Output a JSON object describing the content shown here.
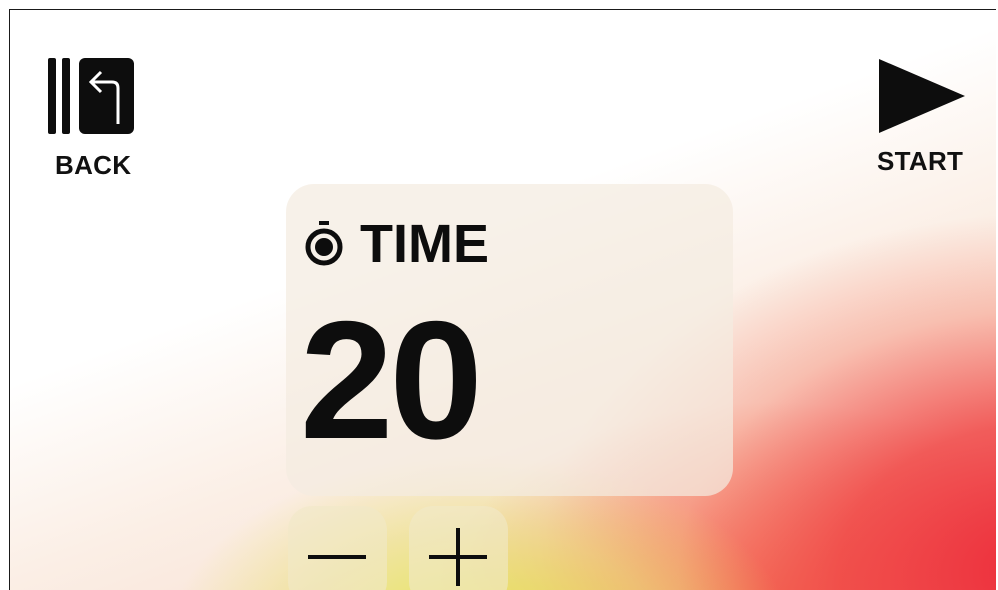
{
  "back": {
    "label": "BACK",
    "icon": "back-door-icon"
  },
  "start": {
    "label": "START",
    "icon": "play-icon"
  },
  "time_card": {
    "title": "TIME",
    "value": "20",
    "icon": "stopwatch-icon"
  },
  "stepper": {
    "minus_icon": "minus-icon",
    "plus_icon": "plus-icon"
  },
  "colors": {
    "text": "#0d0d0d",
    "accent_red": "#ec2838",
    "accent_yellow": "#e2e846"
  }
}
